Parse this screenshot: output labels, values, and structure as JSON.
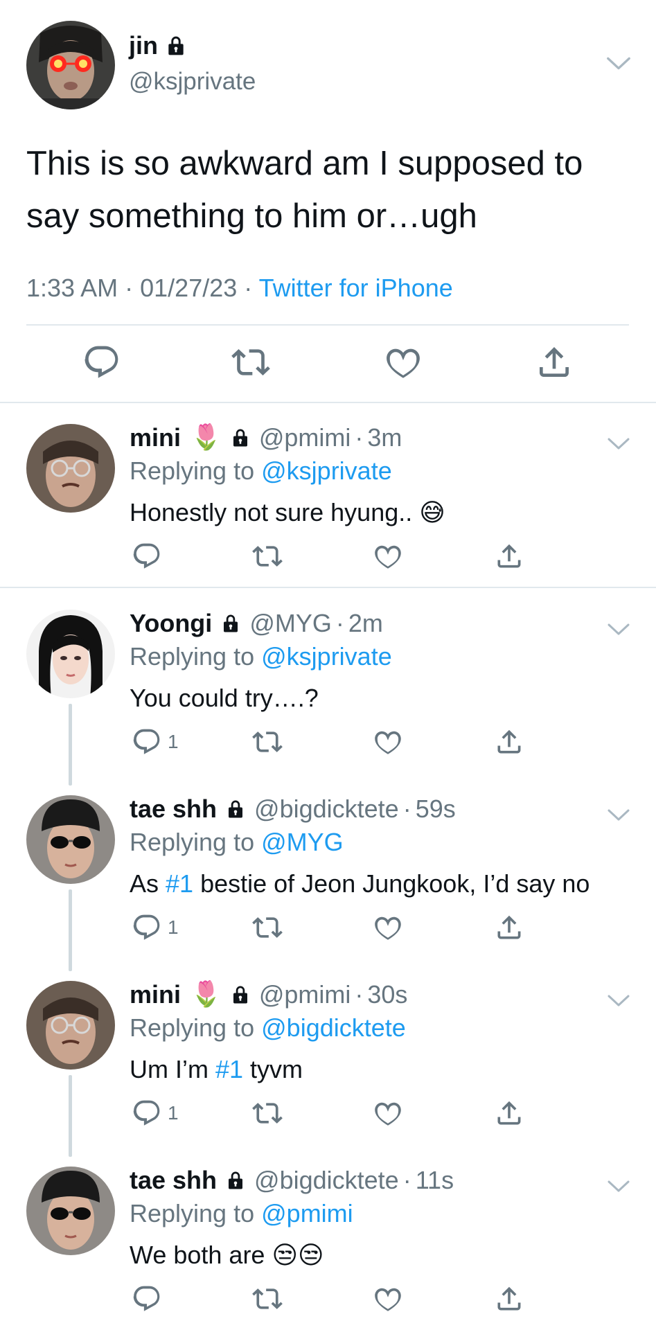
{
  "main": {
    "name": "jin",
    "handle": "@ksjprivate",
    "text": "This is so awkward am I supposed to say something to him or…ugh",
    "time": "1:33 AM",
    "date": "01/27/23",
    "source": "Twitter for iPhone",
    "sep": "·"
  },
  "replies": [
    {
      "name": "mini",
      "flower": "🌷",
      "handle": "@pmimi",
      "time": "3m",
      "replying_label": "Replying to",
      "replying_to": "@ksjprivate",
      "text_before": "Honestly not sure hyung.. ",
      "tag": "",
      "text_after": "😅",
      "reply_count": ""
    },
    {
      "name": "Yoongi",
      "flower": "",
      "handle": "@MYG",
      "time": "2m",
      "replying_label": "Replying to",
      "replying_to": "@ksjprivate",
      "text_before": "You could try….?",
      "tag": "",
      "text_after": "",
      "reply_count": "1"
    },
    {
      "name": "tae shh",
      "flower": "",
      "handle": "@bigdicktete",
      "time": "59s",
      "replying_label": "Replying to",
      "replying_to": "@MYG",
      "text_before": "As ",
      "tag": "#1",
      "text_after": " bestie of Jeon Jungkook, I’d say no",
      "reply_count": "1"
    },
    {
      "name": "mini",
      "flower": "🌷",
      "handle": "@pmimi",
      "time": "30s",
      "replying_label": "Replying to",
      "replying_to": "@bigdicktete",
      "text_before": "Um I’m ",
      "tag": "#1",
      "text_after": " tyvm",
      "reply_count": "1"
    },
    {
      "name": "tae shh",
      "flower": "",
      "handle": "@bigdicktete",
      "time": "11s",
      "replying_label": "Replying to",
      "replying_to": "@pmimi",
      "text_before": "We both are ",
      "tag": "",
      "text_after": "😒😒",
      "reply_count": ""
    }
  ],
  "icons": [
    "reply-icon",
    "retweet-icon",
    "like-icon",
    "share-icon",
    "lock-icon",
    "chevron-down-icon"
  ],
  "colors": {
    "link": "#1d9bf0",
    "secondary": "#66757f",
    "divider": "#e1e8ed",
    "thread": "#cfd9de"
  }
}
